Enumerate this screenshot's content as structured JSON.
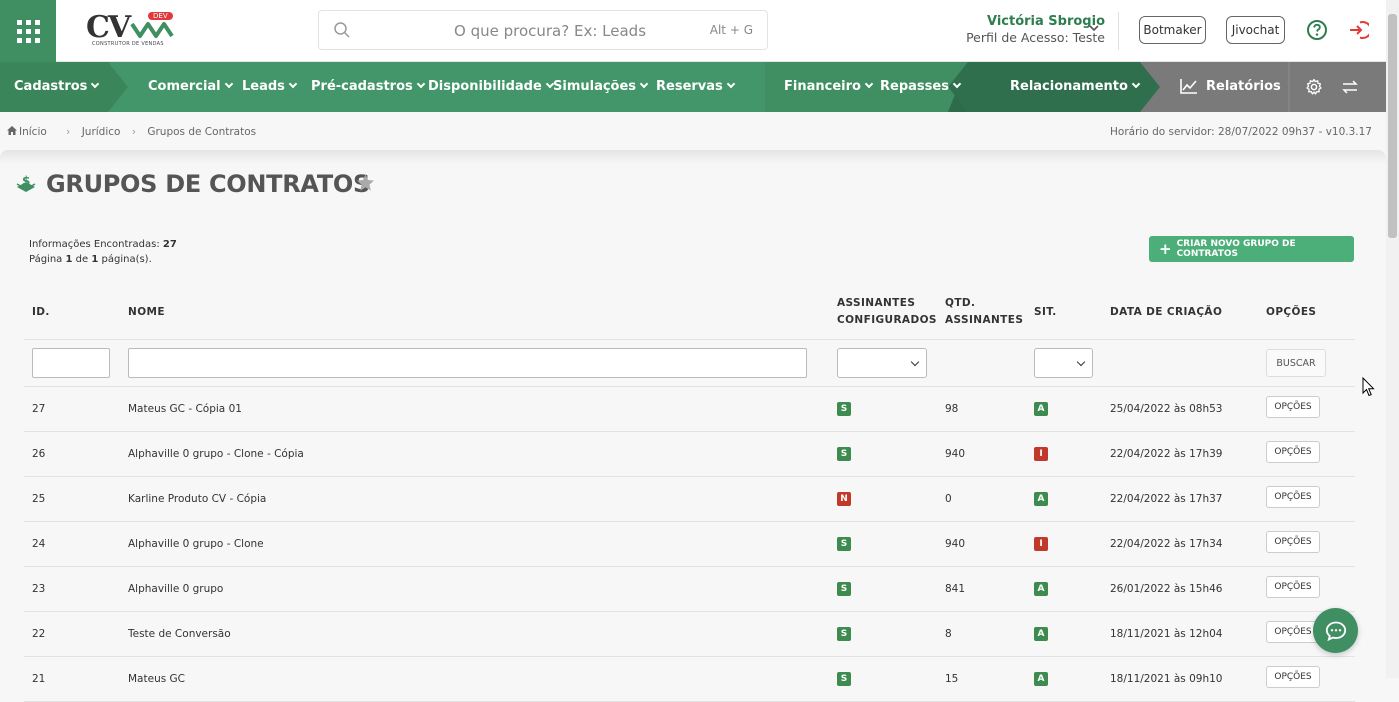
{
  "topbar": {
    "logo_text": "CV",
    "logo_badge": "DEV",
    "logo_subtitle": "CONSTRUTOR DE VENDAS",
    "search_placeholder": "O que procura? Ex: Leads",
    "search_shortcut": "Alt + G",
    "user_name": "Victória Sbrogio",
    "user_profile": "Perfil de Acesso: Teste",
    "botmaker_label": "Botmaker",
    "jivochat_label": "Jivochat"
  },
  "nav": {
    "items": [
      {
        "label": "Cadastros"
      },
      {
        "label": "Comercial"
      },
      {
        "label": "Leads"
      },
      {
        "label": "Pré-cadastros"
      },
      {
        "label": "Disponibilidade"
      },
      {
        "label": "Simulações"
      },
      {
        "label": "Reservas"
      },
      {
        "label": "Financeiro"
      },
      {
        "label": "Repasses"
      },
      {
        "label": "Relacionamento"
      }
    ],
    "reports_label": "Relatórios"
  },
  "breadcrumb": {
    "home": "Início",
    "section": "Jurídico",
    "current": "Grupos de Contratos"
  },
  "server_time": "Horário do servidor: 28/07/2022 09h37 - v10.3.17",
  "page": {
    "title": "GRUPOS DE CONTRATOS",
    "info_found_label": "Informações Encontradas:",
    "info_found_value": "27",
    "page_label": "Página",
    "page_current": "1",
    "page_of": "de",
    "page_total": "1",
    "page_suffix": "página(s).",
    "create_button": "CRIAR NOVO GRUPO DE CONTRATOS"
  },
  "table": {
    "headers": {
      "id": "ID.",
      "name": "NOME",
      "signers_line1": "ASSINANTES",
      "signers_line2": "CONFIGURADOS",
      "qty_line1": "QTD.",
      "qty_line2": "ASSINANTES",
      "sit": "SIT.",
      "date": "DATA DE CRIAÇÃO",
      "options": "OPÇÕES"
    },
    "search_button": "BUSCAR",
    "options_button": "OPÇÕES",
    "rows": [
      {
        "id": "27",
        "name": "Mateus GC - Cópia 01",
        "configured": "S",
        "qty": "98",
        "sit": "A",
        "date": "25/04/2022 às 08h53"
      },
      {
        "id": "26",
        "name": "Alphaville 0 grupo - Clone - Cópia",
        "configured": "S",
        "qty": "940",
        "sit": "I",
        "date": "22/04/2022 às 17h39"
      },
      {
        "id": "25",
        "name": "Karline Produto CV - Cópia",
        "configured": "N",
        "qty": "0",
        "sit": "A",
        "date": "22/04/2022 às 17h37"
      },
      {
        "id": "24",
        "name": "Alphaville 0 grupo - Clone",
        "configured": "S",
        "qty": "940",
        "sit": "I",
        "date": "22/04/2022 às 17h34"
      },
      {
        "id": "23",
        "name": "Alphaville 0 grupo",
        "configured": "S",
        "qty": "841",
        "sit": "A",
        "date": "26/01/2022 às 15h46"
      },
      {
        "id": "22",
        "name": "Teste de Conversão",
        "configured": "S",
        "qty": "8",
        "sit": "A",
        "date": "18/11/2021 às 12h04"
      },
      {
        "id": "21",
        "name": "Mateus GC",
        "configured": "S",
        "qty": "15",
        "sit": "A",
        "date": "18/11/2021 às 09h10"
      }
    ]
  },
  "colors": {
    "brand_green": "#3f8f63",
    "badge_green": "#3d8b4f",
    "badge_red": "#c0392b",
    "accent_red": "#e2393a"
  }
}
